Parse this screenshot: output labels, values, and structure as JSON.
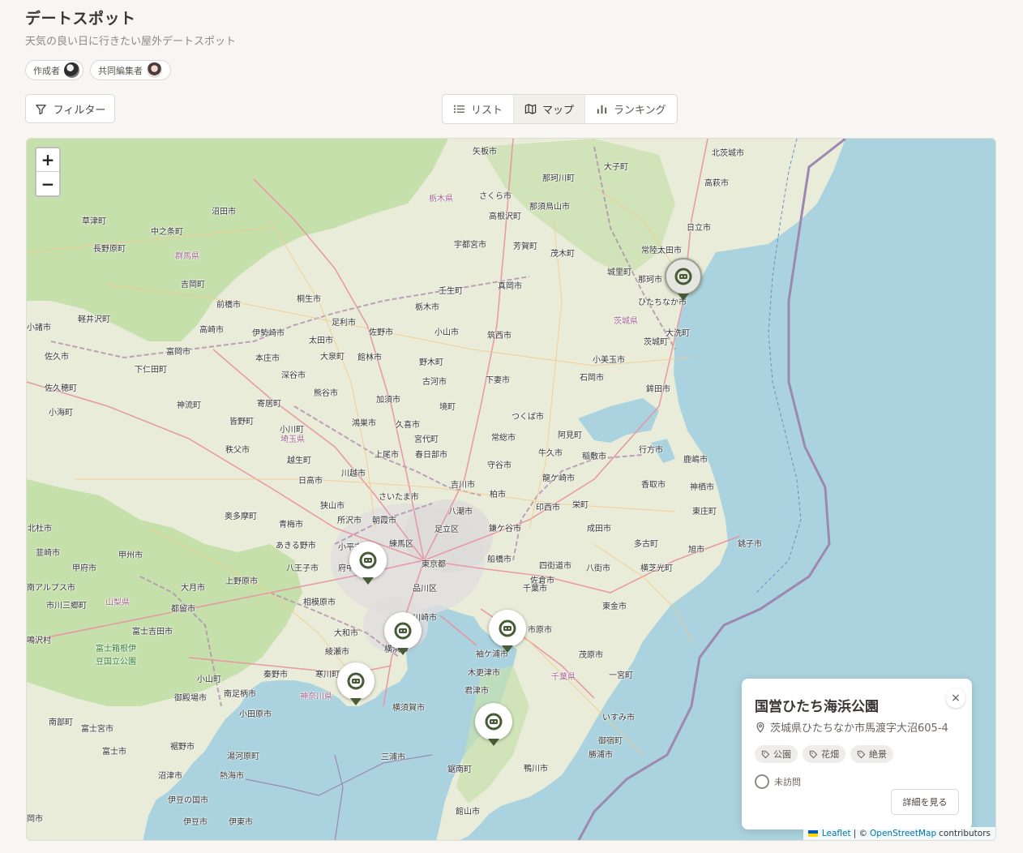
{
  "header": {
    "title": "デートスポット",
    "subtitle": "天気の良い日に行きたい屋外デートスポット"
  },
  "people": {
    "owner_label": "作成者",
    "editor_label": "共同編集者"
  },
  "toolbar": {
    "filter_label": "フィルター",
    "tabs": [
      {
        "label": "リスト",
        "icon": "list-icon",
        "active": false
      },
      {
        "label": "マップ",
        "icon": "map-icon",
        "active": true
      },
      {
        "label": "ランキング",
        "icon": "bar-chart-icon",
        "active": false
      }
    ]
  },
  "map": {
    "zoom_in": "+",
    "zoom_out": "−",
    "labels": [
      "矢板市",
      "北茨城市",
      "大子町",
      "那須烏山市",
      "那珂川町",
      "さくら市",
      "栃木県",
      "高萩市",
      "高根沢町",
      "日立市",
      "沼田市",
      "草津町",
      "中之条町",
      "長野原町",
      "群馬県",
      "宇都宮市",
      "芳賀町",
      "茂木町",
      "常陸太田市",
      "城里町",
      "那珂市",
      "真岡市",
      "吉岡町",
      "壬生町",
      "ひたちなか市",
      "茨城県",
      "大洗町",
      "桐生市",
      "前橋市",
      "栃木市",
      "足利市",
      "小諸市",
      "軽井沢町",
      "高崎市",
      "伊勢崎市",
      "太田市",
      "佐野市",
      "小山市",
      "筑西市",
      "茨城町",
      "富岡市",
      "本庄市",
      "大泉町",
      "館林市",
      "野木町",
      "小美玉市",
      "佐久市",
      "下仁田町",
      "深谷市",
      "古河市",
      "下妻市",
      "石岡市",
      "鉾田市",
      "佐久穂町",
      "熊谷市",
      "神流町",
      "寄居町",
      "加須市",
      "境町",
      "つくば市",
      "小海町",
      "皆野町",
      "鴻巣市",
      "久喜市",
      "常総市",
      "阿見町",
      "小川町",
      "宮代町",
      "行方市",
      "埼玉県",
      "秩父市",
      "上尾市",
      "春日部市",
      "牛久市",
      "稲敷市",
      "鹿嶋市",
      "越生町",
      "守谷市",
      "龍ケ崎市",
      "川越市",
      "日高市",
      "吉川市",
      "香取市",
      "神栖市",
      "狭山市",
      "さいたま市",
      "柏市",
      "奥多摩町",
      "八潮市",
      "印西市",
      "栄町",
      "東庄町",
      "北杜市",
      "青梅市",
      "所沢市",
      "朝霞市",
      "足立区",
      "鎌ケ谷市",
      "成田市",
      "銚子市",
      "韮崎市",
      "あきる野市",
      "小平市",
      "練馬区",
      "多古町",
      "旭市",
      "甲府市",
      "甲州市",
      "八王子市",
      "府中市",
      "東京都",
      "船橋市",
      "佐倉市",
      "四街道市",
      "八街市",
      "横芝光町",
      "南アルプス市",
      "大月市",
      "上野原市",
      "品川区",
      "千葉市",
      "市川三郷町",
      "山梨県",
      "相模原市",
      "都留市",
      "東金市",
      "富士吉田市",
      "大和市",
      "川崎市",
      "市原市",
      "鳴沢村",
      "横浜市",
      "袖ケ浦市",
      "茂原市",
      "綾瀬市",
      "富士箱根伊豆国立公園",
      "秦野市",
      "寒川町",
      "木更津市",
      "千葉県",
      "小山町",
      "一宮町",
      "御殿場市",
      "南足柄市",
      "神奈川県",
      "君津市",
      "横須賀市",
      "小田原市",
      "いすみ市",
      "南部町",
      "富士宮市",
      "御宿町",
      "裾野市",
      "湯河原町",
      "三浦市",
      "富士市",
      "勝浦市",
      "熱海市",
      "沼津市",
      "鋸南町",
      "鴨川市",
      "伊豆の国市",
      "館山市",
      "伊豆市",
      "伊東市",
      "岡市"
    ],
    "attribution": {
      "leaflet": "Leaflet",
      "separator": "| ©",
      "osm": "OpenStreetMap",
      "suffix": "contributors"
    }
  },
  "popup": {
    "title": "国営ひたち海浜公園",
    "address": "茨城県ひたちなか市馬渡字大沼605-4",
    "tags": [
      "公園",
      "花畑",
      "絶景"
    ],
    "visit_status": "未訪問",
    "detail_button": "詳細を見る",
    "close_icon": "×"
  },
  "colors": {
    "marker_green": "#465b36",
    "land": "#e9ecd8",
    "sea": "#aad3df",
    "forest": "#b9dc9e"
  }
}
